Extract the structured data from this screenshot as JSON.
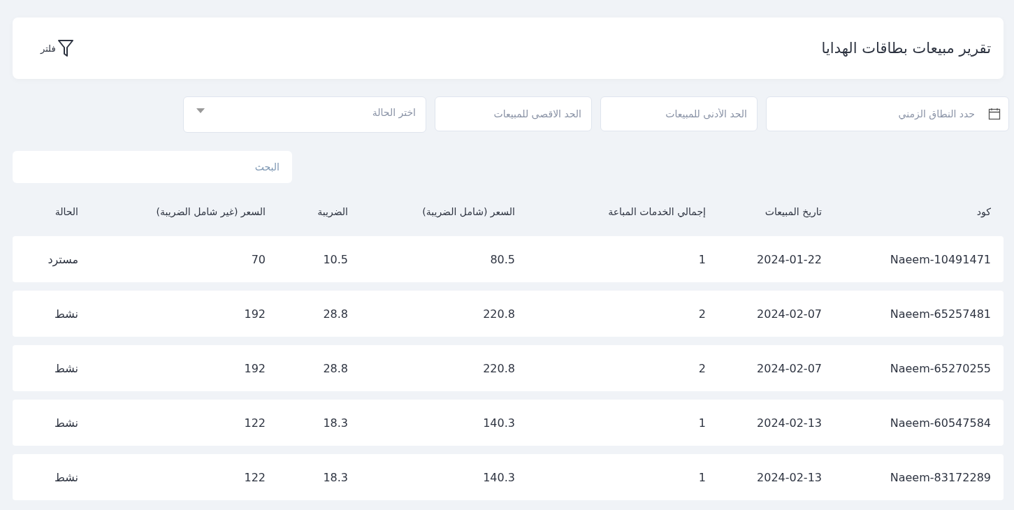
{
  "header": {
    "title": "تقرير مبيعات بطاقات الهدايا",
    "filter_button": "فلتر"
  },
  "filters": {
    "date_range": {
      "placeholder": "حدد النطاق الزمني"
    },
    "min_sales": {
      "placeholder": "الحد الأدنى للمبيعات"
    },
    "max_sales": {
      "placeholder": "الحد الاقصى للمبيعات"
    },
    "status": {
      "placeholder": "اختر الحالة"
    }
  },
  "search": {
    "placeholder": "البحث"
  },
  "table": {
    "columns": [
      "كود",
      "تاريخ المبيعات",
      "إجمالي الخدمات المباعة",
      "السعر (شامل الضريبة)",
      "الضريبة",
      "السعر (غير شامل الضريبة)",
      "الحالة"
    ],
    "rows": [
      [
        "Naeem-10491471",
        "2024-01-22",
        "1",
        "80.5",
        "10.5",
        "70",
        "مسترد"
      ],
      [
        "Naeem-65257481",
        "2024-02-07",
        "2",
        "220.8",
        "28.8",
        "192",
        "نشط"
      ],
      [
        "Naeem-65270255",
        "2024-02-07",
        "2",
        "220.8",
        "28.8",
        "192",
        "نشط"
      ],
      [
        "Naeem-60547584",
        "2024-02-13",
        "1",
        "140.3",
        "18.3",
        "122",
        "نشط"
      ],
      [
        "Naeem-83172289",
        "2024-02-13",
        "1",
        "140.3",
        "18.3",
        "122",
        "نشط"
      ]
    ]
  }
}
